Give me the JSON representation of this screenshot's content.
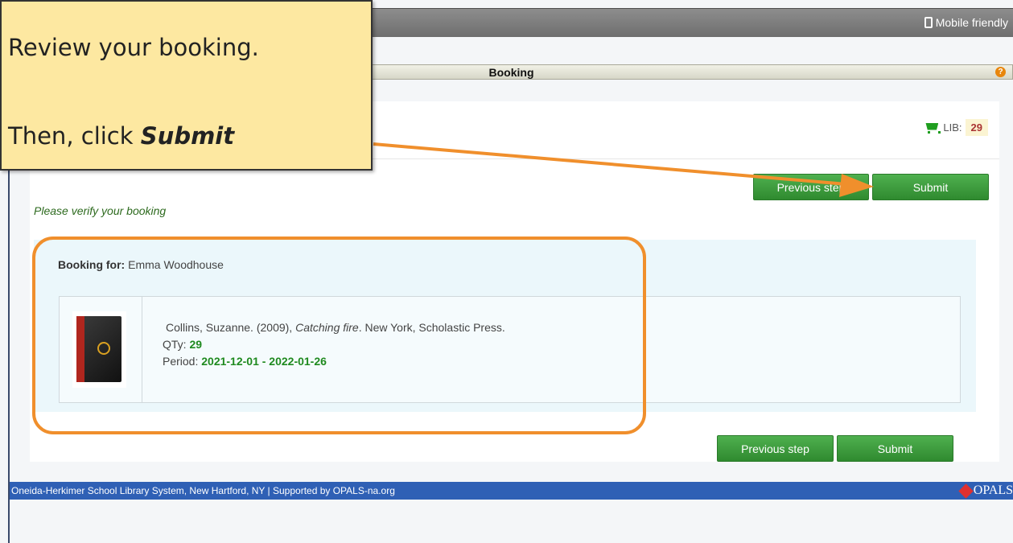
{
  "topbar": {
    "mobile_label": "Mobile friendly"
  },
  "section": {
    "title": "Booking",
    "help_glyph": "?"
  },
  "cart": {
    "label": "LIB:",
    "count": "29"
  },
  "buttons": {
    "previous_label": "Previous step",
    "submit_label": "Submit"
  },
  "verify_text": "Please verify your booking",
  "booking": {
    "for_label": "Booking for:",
    "patron": "Emma Woodhouse",
    "item": {
      "citation_before": "Collins, Suzanne. (2009),",
      "title": "Catching fire",
      "citation_after": ". New York, Scholastic Press.",
      "qty_label": "QTy:",
      "qty": "29",
      "period_label": "Period:",
      "period": "2021-12-01 - 2022-01-26"
    }
  },
  "footer": {
    "text": "Oneida-Herkimer School Library System, New Hartford, NY | Supported by OPALS-na.org",
    "logo": "OPALS"
  },
  "callout": {
    "line1": "Review your booking.",
    "line2_prefix": "Then, click",
    "line2_emphasis": "Submit"
  },
  "colors": {
    "accent_orange": "#f08f2c",
    "button_green": "#3d9e3d",
    "footer_blue": "#2f60b5",
    "callout_yellow": "#fde8a1"
  },
  "icons": [
    "phone-icon",
    "help-icon",
    "cart-icon",
    "book-cover-image",
    "opals-diamond-icon",
    "arrow-annotation"
  ]
}
